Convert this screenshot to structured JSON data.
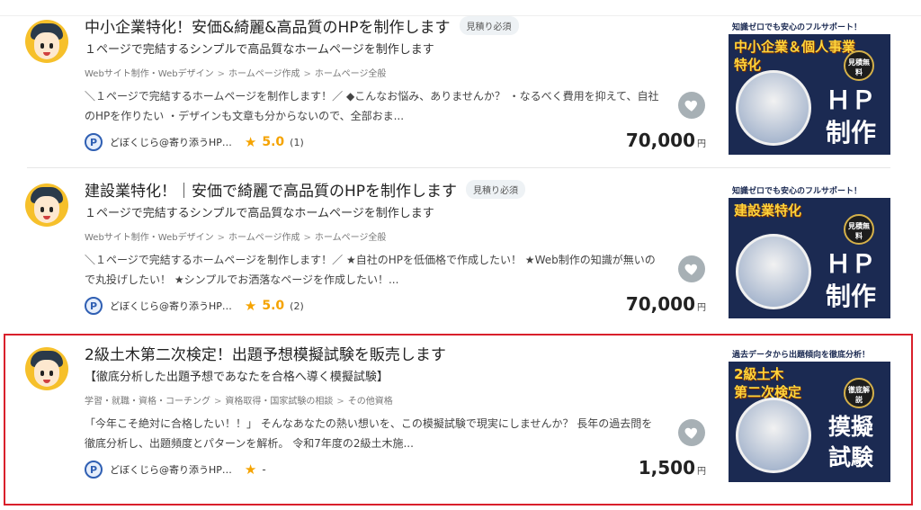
{
  "listings": [
    {
      "title": "中小企業特化！安価&綺麗&高品質のHPを制作します",
      "badge": "見積り必須",
      "subtitle": "１ページで完結するシンプルで高品質なホームページを制作します",
      "breadcrumb": [
        "Webサイト制作・Webデザイン",
        "ホームページ作成",
        "ホームページ全般"
      ],
      "description": "＼１ページで完結するホームページを制作します！／ ◆こんなお悩み、ありませんか？ ・なるべく費用を抑えて、自社のHPを作りたい ・デザインも文章も分からないので、全部おま...",
      "seller": "どぼくじら@寄り添うHP…",
      "rating": "5.0",
      "review_count": "(1)",
      "price": "70,000",
      "currency": "円",
      "thumbnail": {
        "banner": "知識ゼロでも安心のフルサポート！",
        "headline": "中小企業＆個人事業",
        "headline2": "特化",
        "seal": "見積無料",
        "big1": "ＨＰ",
        "big2": "制作"
      }
    },
    {
      "title": "建設業特化！｜安価で綺麗で高品質のHPを制作します",
      "badge": "見積り必須",
      "subtitle": "１ページで完結するシンプルで高品質なホームページを制作します",
      "breadcrumb": [
        "Webサイト制作・Webデザイン",
        "ホームページ作成",
        "ホームページ全般"
      ],
      "description": "＼１ページで完結するホームページを制作します！／ ★自社のHPを低価格で作成したい！ ★Web制作の知識が無いので丸投げしたい！ ★シンプルでお洒落なページを作成したい！...",
      "seller": "どぼくじら@寄り添うHP…",
      "rating": "5.0",
      "review_count": "(2)",
      "price": "70,000",
      "currency": "円",
      "thumbnail": {
        "banner": "知識ゼロでも安心のフルサポート！",
        "headline": "建設業特化",
        "headline2": "",
        "seal": "見積無料",
        "big1": "ＨＰ",
        "big2": "制作"
      }
    },
    {
      "title": "2級土木第二次検定！出題予想模擬試験を販売します",
      "badge": "",
      "subtitle": "【徹底分析した出題予想であなたを合格へ導く模擬試験】",
      "breadcrumb": [
        "学習・就職・資格・コーチング",
        "資格取得・国家試験の相談",
        "その他資格"
      ],
      "description": "「今年こそ絶対に合格したい！！」 そんなあなたの熱い想いを、この模擬試験で現実にしませんか？ 長年の過去問を徹底分析し、出題頻度とパターンを解析。 令和7年度の2級土木施...",
      "seller": "どぼくじら@寄り添うHP…",
      "rating": "-",
      "review_count": "",
      "price": "1,500",
      "currency": "円",
      "thumbnail": {
        "banner": "過去データから出題傾向を徹底分析！",
        "headline": "2級土木",
        "headline2": "第二次検定",
        "seal": "徹底解説",
        "big1": "摸擬",
        "big2": "試験"
      }
    }
  ]
}
